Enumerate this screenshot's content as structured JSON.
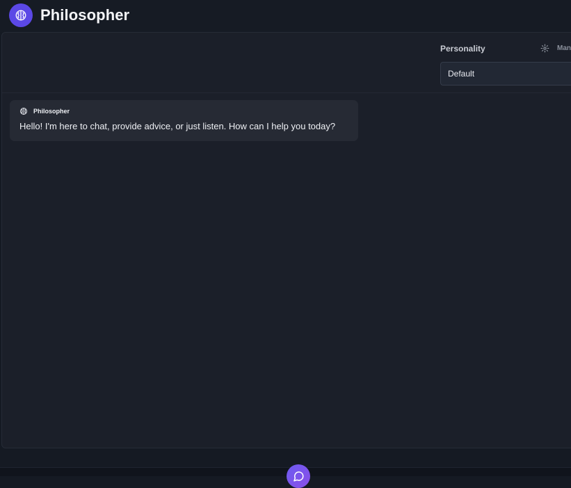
{
  "app": {
    "title": "Philosopher",
    "logo_icon": "brain-icon",
    "accent_color": "#5b48e6"
  },
  "settings": {
    "personality_label": "Personality",
    "manage_label": "Man",
    "manage_icon": "gear-icon",
    "personality_selected": "Default"
  },
  "chat": {
    "messages": [
      {
        "sender": "Philosopher",
        "icon": "brain-icon",
        "text": "Hello! I'm here to chat, provide advice, or just listen. How can I help you today?"
      }
    ]
  },
  "footer": {
    "action_icon": "chat-icon"
  }
}
